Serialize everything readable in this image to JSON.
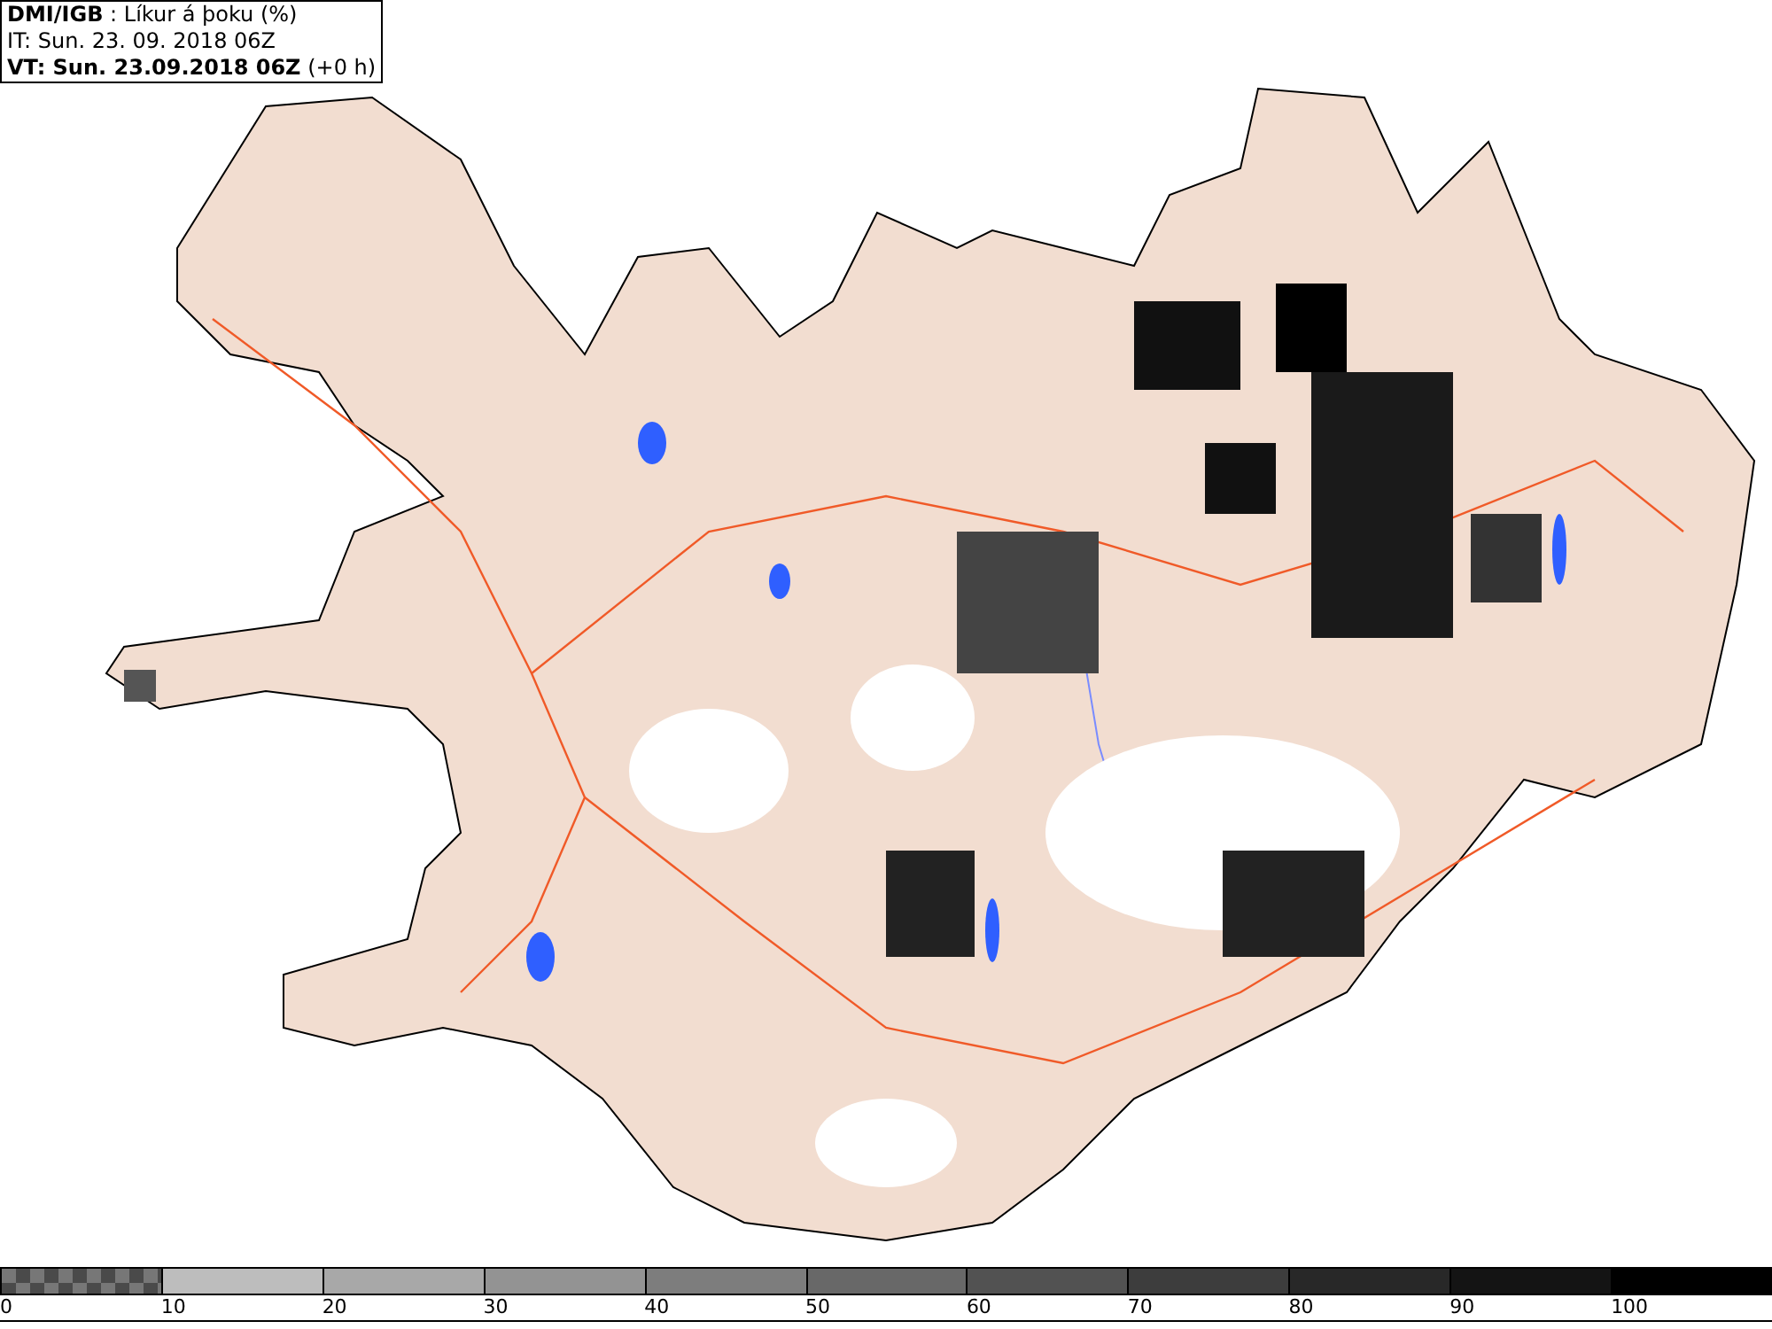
{
  "header": {
    "source": "DMI/IGB",
    "product": " : Líkur á þoku (%)",
    "issue_time": "IT: Sun. 23. 09. 2018 06Z",
    "valid_time": "VT: Sun. 23.09.2018 06Z",
    "lead": "(+0 h)"
  },
  "legend": [
    {
      "label": "0",
      "kind": "pattern",
      "color": "#4a4a4a"
    },
    {
      "label": "10",
      "kind": "solid",
      "color": "#bdbdbd"
    },
    {
      "label": "20",
      "kind": "solid",
      "color": "#a8a8a8"
    },
    {
      "label": "30",
      "kind": "solid",
      "color": "#939393"
    },
    {
      "label": "40",
      "kind": "solid",
      "color": "#7d7d7d"
    },
    {
      "label": "50",
      "kind": "solid",
      "color": "#686868"
    },
    {
      "label": "60",
      "kind": "solid",
      "color": "#525252"
    },
    {
      "label": "70",
      "kind": "solid",
      "color": "#3d3d3d"
    },
    {
      "label": "80",
      "kind": "solid",
      "color": "#282828"
    },
    {
      "label": "90",
      "kind": "solid",
      "color": "#141414"
    },
    {
      "label": "100",
      "kind": "solid",
      "color": "#000000"
    }
  ]
}
